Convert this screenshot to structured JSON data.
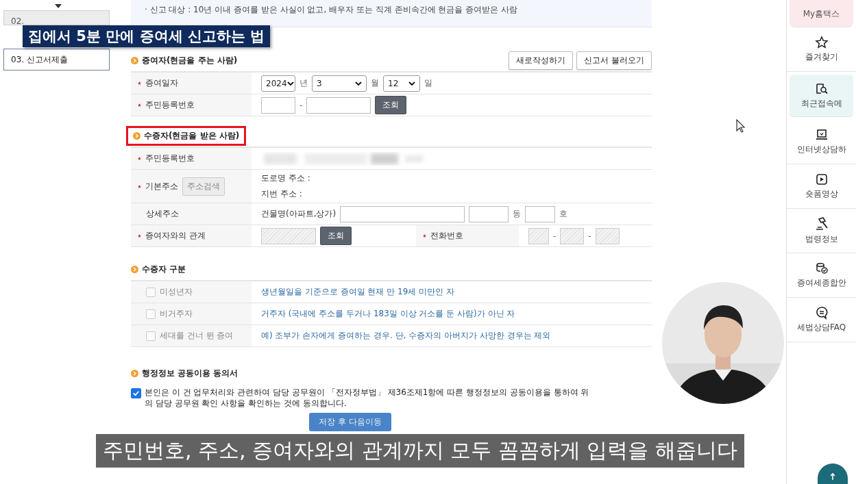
{
  "nav": {
    "items": [
      {
        "label": "02.",
        "selected": false
      },
      {
        "label": "03. 신고서제출",
        "selected": true
      }
    ]
  },
  "notice": "· 신고 대상 : 10년 이내 증여를 받은 사실이 없고, 배우자 또는 직계 존비속간에 현금을 증여받은 사람",
  "actions": [
    "새로작성하기",
    "신고서 불러오기"
  ],
  "donor": {
    "title": "증여자(현금을 주는 사람)",
    "date": {
      "label": "증여일자",
      "required": true,
      "year": "2024",
      "year_unit": "년",
      "month": "3",
      "month_unit": "월",
      "day": "12",
      "day_unit": "일"
    },
    "id": {
      "label": "주민등록번호",
      "required": true,
      "separator": "-",
      "lookup": "조회"
    }
  },
  "recipient": {
    "title": "수증자(현금을 받은 사람)",
    "highlighted": true,
    "id": {
      "label": "주민등록번호",
      "required": true
    },
    "address": {
      "label": "기본주소",
      "required": true,
      "search": "주소검색",
      "road": "도로명 주소 :",
      "lot": "지번 주소 :"
    },
    "detail": {
      "label": "상세주소",
      "building": "건물명(아파트,상가)",
      "dong": "동",
      "ho": "호"
    },
    "relation": {
      "label": "증여자와의 관계",
      "required": true,
      "lookup": "조회"
    },
    "phone": {
      "label": "전화번호",
      "required": true,
      "separators": [
        "-",
        "-"
      ]
    }
  },
  "category": {
    "title": "수증자 구분",
    "rows": [
      {
        "label": "미성년자",
        "checked": false,
        "desc": "생년월일을 기준으로 증여일 현재 만 19세 미만인 자"
      },
      {
        "label": "비거주자",
        "checked": false,
        "desc": "거주자 (국내에 주소를 두거나 183일 이상 거소를 둔 사람)가 아닌 자"
      },
      {
        "label": "세대를 건너 뛴 증여",
        "checked": false,
        "desc": "예) 조부가 손자에게 증여하는 경우. 단, 수증자의 아버지가 사망한 경우는 제외"
      }
    ]
  },
  "consent": {
    "title": "행정정보 공동이용 동의서",
    "checked": true,
    "text": "본인은 이 건 업무처리와 관련하여 담당 공무원이 「전자정부법」 제36조제1항에 따른 행정정보의 공동이용을 통하여 위의 담당 공무원 확인 사항을 확인하는 것에 동의합니다."
  },
  "next_button": "저장 후 다음이동",
  "sidebar": {
    "items": [
      {
        "label": "My홈택스",
        "kind": "banner",
        "selected": false
      },
      {
        "label": "즐겨찾기",
        "kind": "star",
        "selected": false
      },
      {
        "label": "최근접속메",
        "kind": "search",
        "selected": true
      },
      {
        "label": "인터넷상담하",
        "kind": "laptop",
        "selected": false
      },
      {
        "label": "숏폼영상",
        "kind": "play",
        "selected": false
      },
      {
        "label": "법령정보",
        "kind": "gavel",
        "selected": false
      },
      {
        "label": "증여세종합안",
        "kind": "coins",
        "selected": false
      },
      {
        "label": "세법상담FAQ",
        "kind": "chat",
        "selected": false
      }
    ]
  },
  "caption": "집에서 5분 만에 증여세 신고하는 법",
  "subtitle": "주민번호, 주소, 증여자와의 관계까지 모두 꼼꼼하게 입력을 해줍니다"
}
